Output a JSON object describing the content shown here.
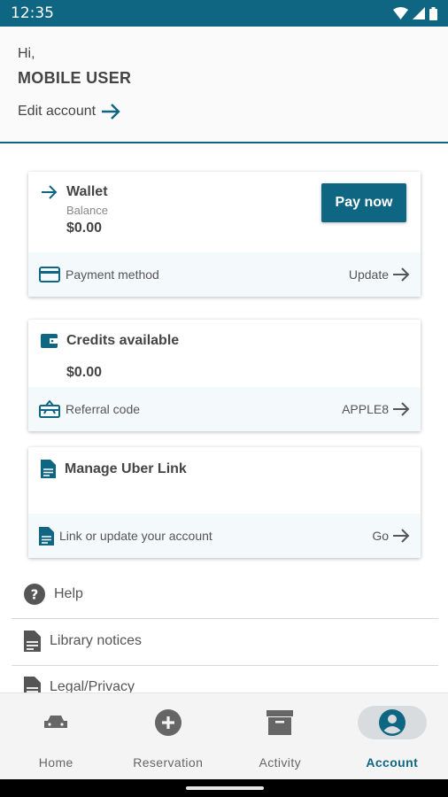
{
  "status_bar": {
    "time": "12:35"
  },
  "header": {
    "greeting": "Hi,",
    "username": "MOBILE USER",
    "edit_link": "Edit account"
  },
  "wallet": {
    "title": "Wallet",
    "balance_label": "Balance",
    "amount": "$0.00",
    "pay_button": "Pay now",
    "footer_label": "Payment method",
    "footer_action": "Update"
  },
  "credits": {
    "title": "Credits available",
    "amount": "$0.00",
    "footer_label": "Referral code",
    "footer_action": "APPLE8"
  },
  "uber_link": {
    "title": "Manage Uber Link",
    "footer_label": "Link or update your account",
    "footer_action": "Go"
  },
  "menu": [
    {
      "label": "Help",
      "icon": "help-icon"
    },
    {
      "label": "Library notices",
      "icon": "document-icon"
    },
    {
      "label": "Legal/Privacy",
      "icon": "document-icon"
    }
  ],
  "bottom_nav": [
    {
      "label": "Home",
      "icon": "car-icon",
      "active": false
    },
    {
      "label": "Reservation",
      "icon": "add-circle-icon",
      "active": false
    },
    {
      "label": "Activity",
      "icon": "archive-icon",
      "active": false
    },
    {
      "label": "Account",
      "icon": "account-circle-icon",
      "active": true
    }
  ],
  "colors": {
    "primary": "#0f6682",
    "footer_bg": "#f4f9fb",
    "nav_active_pill": "#d9dcde"
  }
}
